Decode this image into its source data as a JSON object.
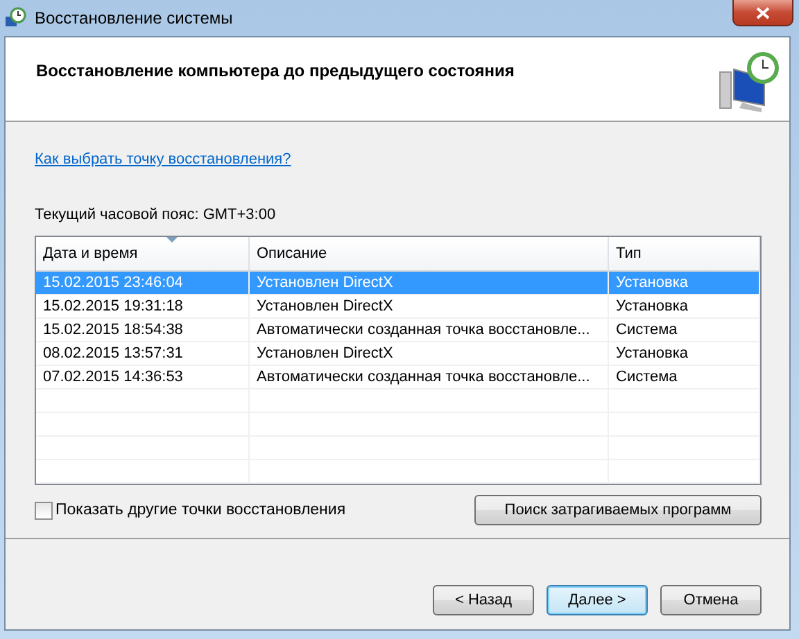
{
  "window": {
    "title": "Восстановление системы"
  },
  "header": {
    "title": "Восстановление компьютера до предыдущего состояния"
  },
  "help_link": "Как выбрать точку восстановления?",
  "timezone": "Текущий часовой пояс: GMT+3:00",
  "table": {
    "columns": [
      "Дата и время",
      "Описание",
      "Тип"
    ],
    "rows": [
      {
        "cells": [
          "15.02.2015 23:46:04",
          "Установлен DirectX",
          "Установка"
        ],
        "selected": true
      },
      {
        "cells": [
          "15.02.2015 19:31:18",
          "Установлен DirectX",
          "Установка"
        ],
        "selected": false
      },
      {
        "cells": [
          "15.02.2015 18:54:38",
          "Автоматически созданная точка восстановле...",
          "Система"
        ],
        "selected": false
      },
      {
        "cells": [
          "08.02.2015 13:57:31",
          "Установлен DirectX",
          "Установка"
        ],
        "selected": false
      },
      {
        "cells": [
          "07.02.2015 14:36:53",
          "Автоматически созданная точка восстановле...",
          "Система"
        ],
        "selected": false
      }
    ]
  },
  "show_more": {
    "label": "Показать другие точки восстановления",
    "checked": false
  },
  "scan_button": "Поиск затрагиваемых программ",
  "buttons": [
    {
      "label": "< Назад",
      "default": false
    },
    {
      "label": "Далее >",
      "default": true
    },
    {
      "label": "Отмена",
      "default": false
    }
  ]
}
